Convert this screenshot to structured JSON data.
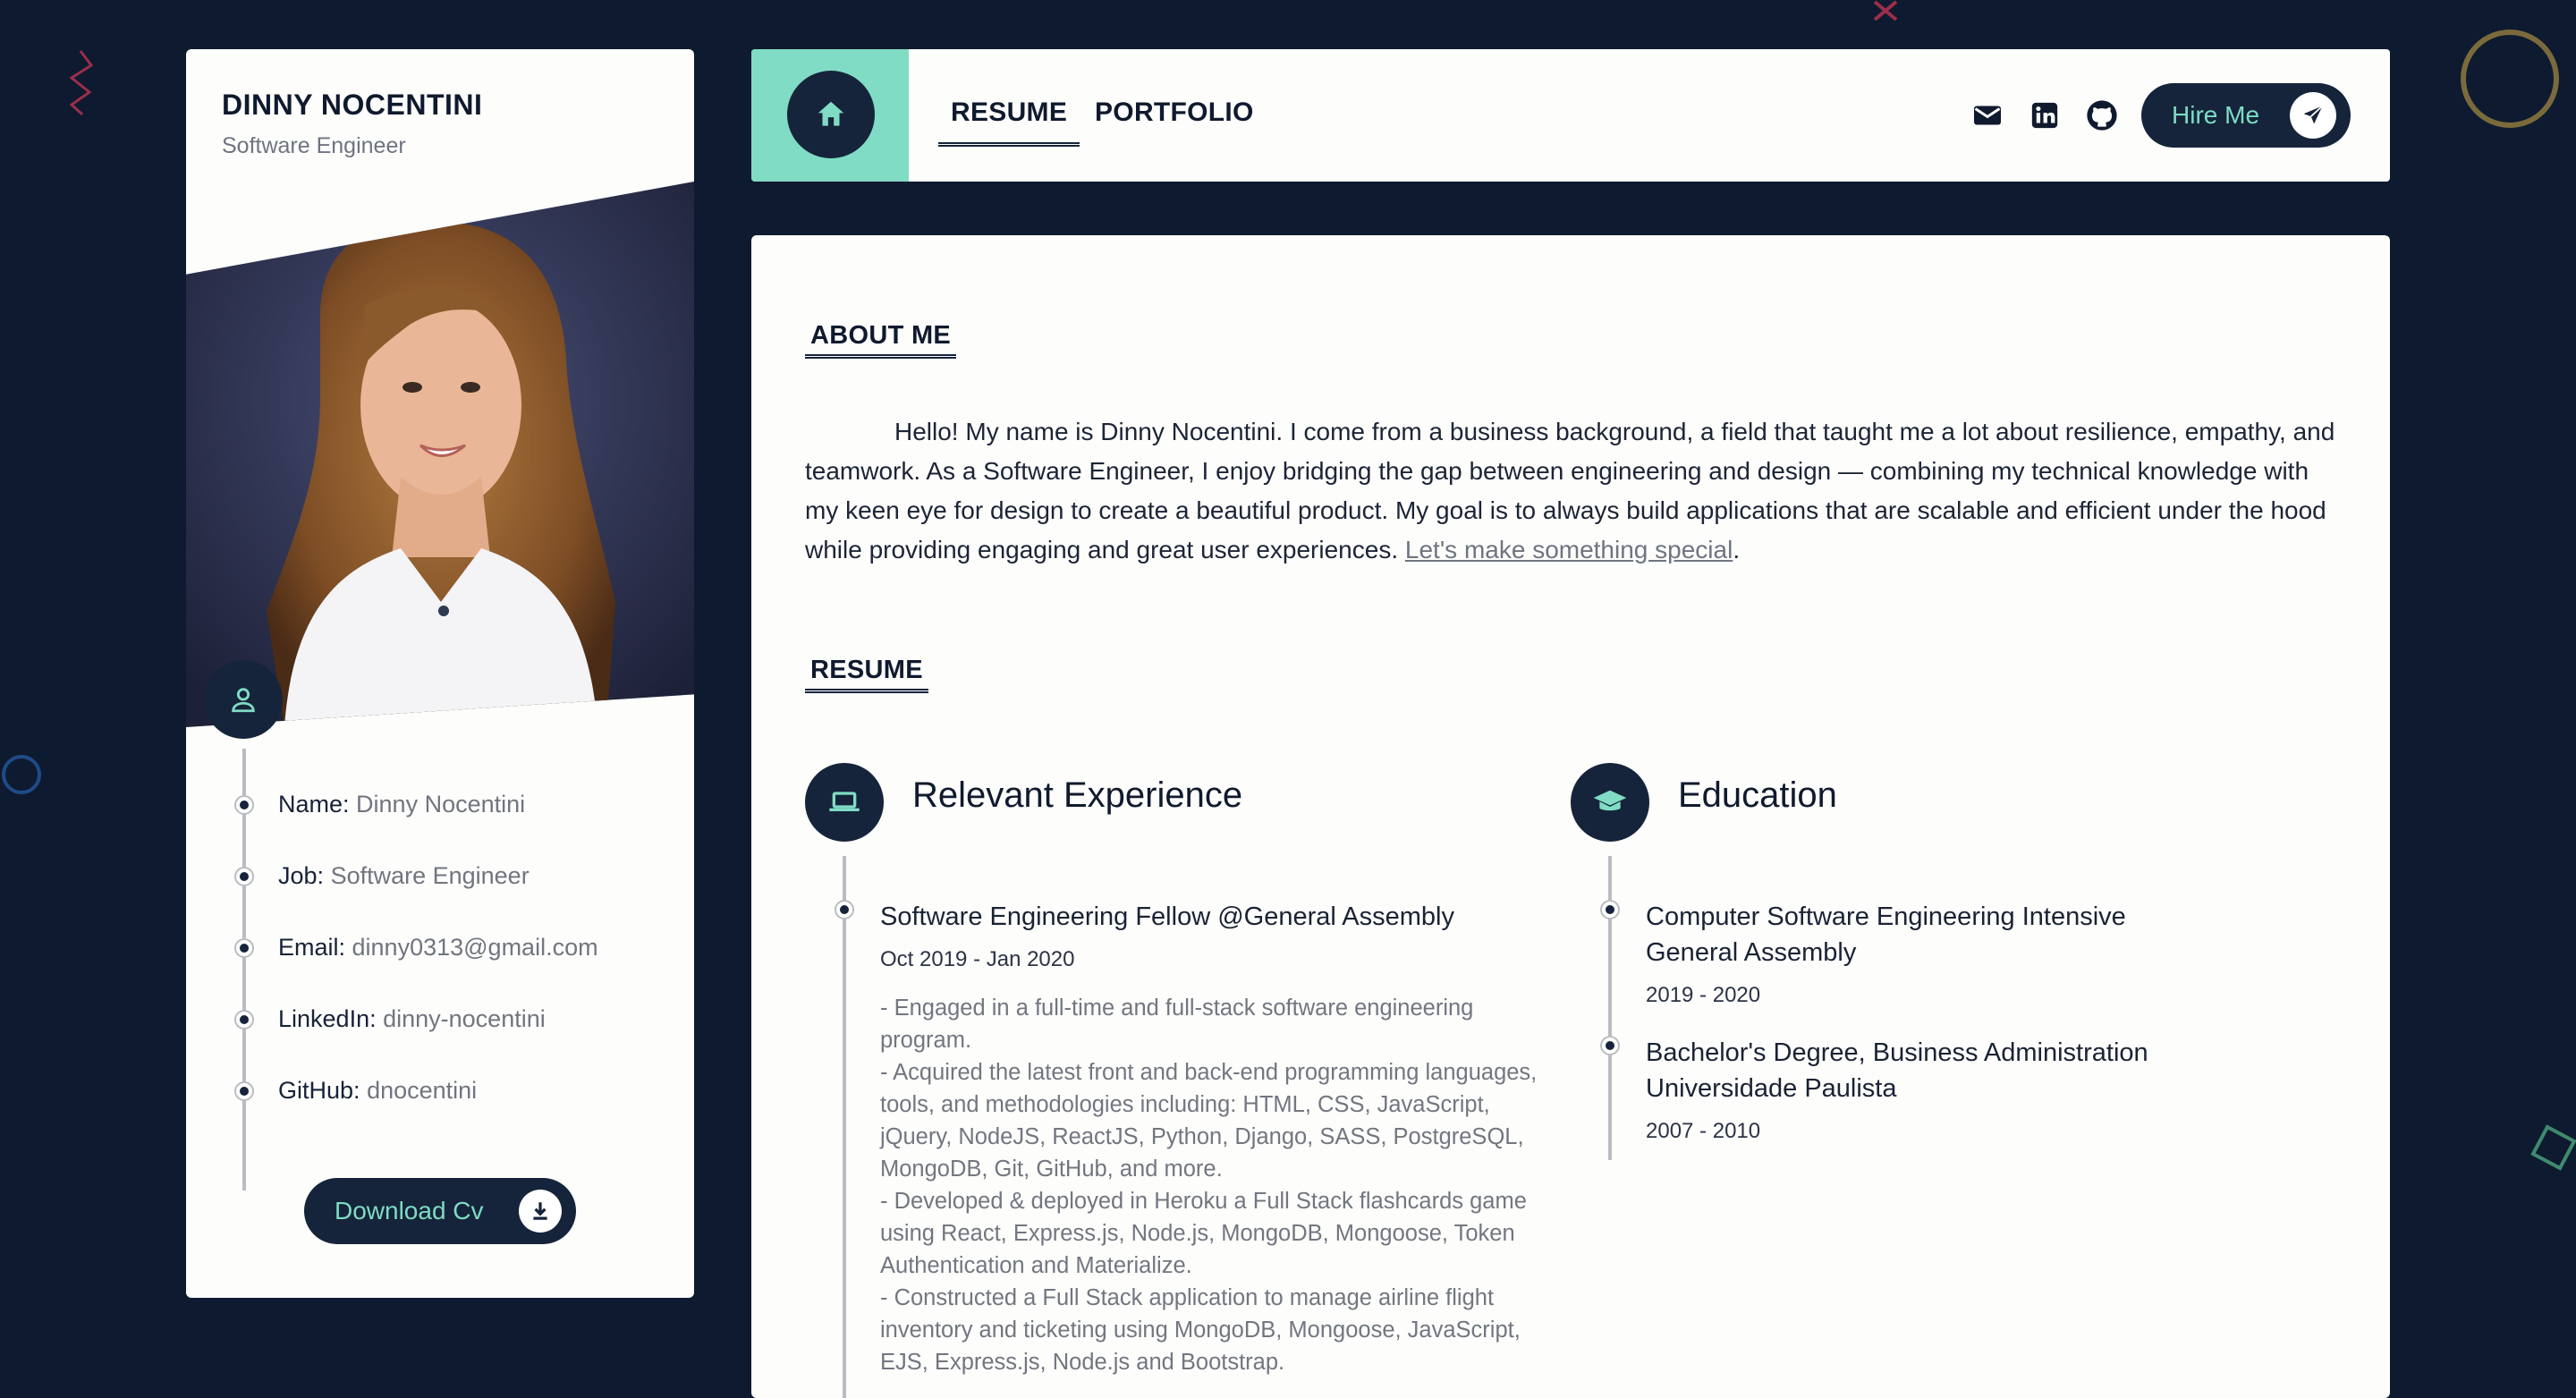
{
  "colors": {
    "navy": "#15243a",
    "mint": "#80dcc4",
    "background": "#0e1a2f",
    "card": "#fdfdfc"
  },
  "profile": {
    "name": "DINNY NOCENTINI",
    "role": "Software Engineer",
    "avatar_icon": "person-icon",
    "info": [
      {
        "label": "Name:",
        "value": "Dinny Nocentini"
      },
      {
        "label": "Job:",
        "value": "Software Engineer"
      },
      {
        "label": "Email:",
        "value": "dinny0313@gmail.com"
      },
      {
        "label": "LinkedIn:",
        "value": "dinny-nocentini"
      },
      {
        "label": "GitHub:",
        "value": "dnocentini"
      }
    ],
    "download_label": "Download Cv",
    "download_icon": "download-icon"
  },
  "nav": {
    "home_icon": "home-icon",
    "tabs": [
      {
        "label": "RESUME",
        "active": true
      },
      {
        "label": "PORTFOLIO",
        "active": false
      }
    ],
    "social_icons": [
      "mail-icon",
      "linkedin-icon",
      "github-icon"
    ],
    "hire_label": "Hire Me",
    "hire_icon": "paper-plane-icon"
  },
  "about": {
    "title": "ABOUT ME",
    "text": "Hello! My name is Dinny Nocentini. I come from a business background, a field that taught me a lot about resilience, empathy, and teamwork. As a Software Engineer, I enjoy bridging the gap between engineering and design — combining my technical knowledge with my keen eye for design to create a beautiful product. My goal is to always build applications that are scalable and efficient under the hood while providing engaging and great user experiences. ",
    "link": "Let's make something special",
    "end": "."
  },
  "resume": {
    "title": "RESUME",
    "experience": {
      "heading": "Relevant Experience",
      "icon": "laptop-icon",
      "entries": [
        {
          "title": "Software Engineering Fellow @General Assembly",
          "date": "Oct 2019 - Jan 2020",
          "description": "- Engaged in a full-time and full-stack software engineering program.\n- Acquired the latest front and back-end programming languages, tools, and methodologies including: HTML, CSS, JavaScript, jQuery, NodeJS, ReactJS, Python, Django, SASS, PostgreSQL, MongoDB, Git, GitHub, and more.\n- Developed & deployed in Heroku a Full Stack flashcards game using React, Express.js, Node.js, MongoDB, Mongoose, Token Authentication and Materialize.\n- Constructed a Full Stack application to manage airline flight inventory and ticketing using MongoDB, Mongoose, JavaScript, EJS, Express.js, Node.js and Bootstrap."
        }
      ]
    },
    "education": {
      "heading": "Education",
      "icon": "graduation-cap-icon",
      "entries": [
        {
          "title": "Computer Software Engineering Intensive",
          "school": "General Assembly",
          "date": "2019 - 2020"
        },
        {
          "title": "Bachelor's Degree, Business Administration",
          "school": "Universidade Paulista",
          "date": "2007 - 2010"
        }
      ]
    }
  }
}
